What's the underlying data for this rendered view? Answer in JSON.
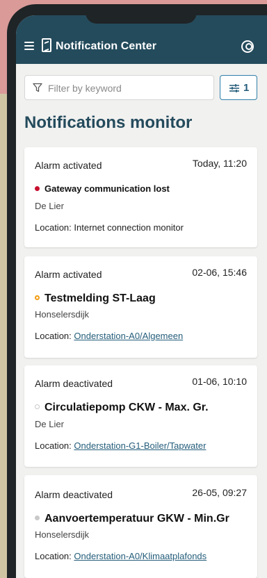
{
  "app": {
    "title": "Notification Center"
  },
  "filter": {
    "placeholder": "Filter by keyword",
    "count": "1"
  },
  "heading": "Notifications monitor",
  "location_prefix": "Location:",
  "cards": [
    {
      "status": "Alarm activated",
      "time": "Today, 11:20",
      "name": "Gateway communication lost",
      "place": "De Lier",
      "location": "Internet connection monitor",
      "dot_color": "#c8102e",
      "dot_style": "filled"
    },
    {
      "status": "Alarm activated",
      "time": "02-06, 15:46",
      "name": "Testmelding ST-Laag",
      "place": "Honselersdijk",
      "location": "Onderstation-A0/Algemeen",
      "dot_color": "#f39c12",
      "dot_style": "ring"
    },
    {
      "status": "Alarm deactivated",
      "time": "01-06, 10:10",
      "name": "Circulatiepomp CKW - Max. Gr.",
      "place": "De Lier",
      "location": "Onderstation-G1-Boiler/Tapwater",
      "dot_color": "#c9c9c9",
      "dot_style": "ring"
    },
    {
      "status": "Alarm deactivated",
      "time": "26-05, 09:27",
      "name": "Aanvoertemperatuur GKW - Min.Gr",
      "place": "Honselersdijk",
      "location": "Onderstation-A0/Klimaatplafonds",
      "dot_color": "#c9c9c9",
      "dot_style": "filled"
    }
  ]
}
